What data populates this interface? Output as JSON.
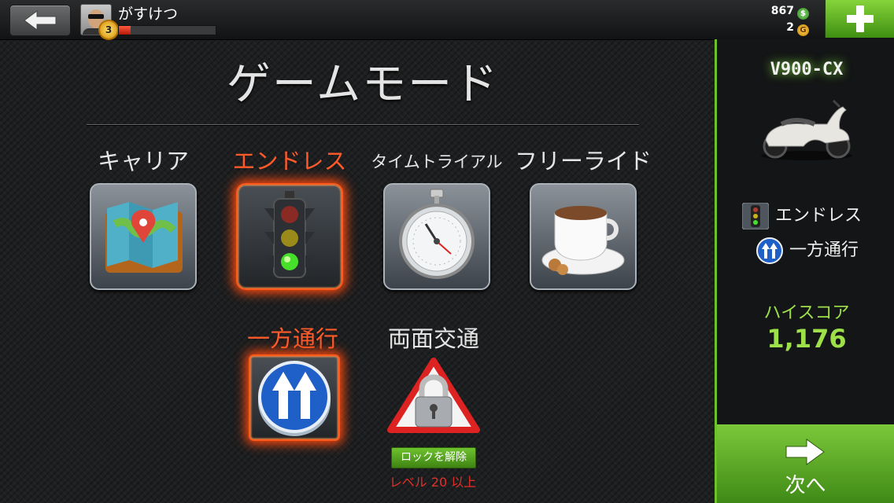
{
  "header": {
    "player_name": "がすけつ",
    "level": "3",
    "xp_progress": 0.12,
    "cash": "867",
    "cash_symbol": "$",
    "gold": "2",
    "gold_symbol": "G"
  },
  "main": {
    "title": "ゲームモード",
    "modes": [
      {
        "label": "キャリア",
        "icon": "map-pin-icon",
        "selected": false
      },
      {
        "label": "エンドレス",
        "icon": "traffic-light-icon",
        "selected": true
      },
      {
        "label": "タイムトライアル",
        "icon": "stopwatch-icon",
        "selected": false
      },
      {
        "label": "フリーライド",
        "icon": "coffee-cup-icon",
        "selected": false
      }
    ],
    "traffic": [
      {
        "label": "一方通行",
        "icon": "one-way-arrows-icon",
        "selected": true
      },
      {
        "label": "両面交通",
        "icon": "padlock-warning-icon",
        "selected": false,
        "locked": true
      }
    ],
    "unlock_button": "ロックを解除",
    "unlock_requirement": "レベル 20 以上"
  },
  "side": {
    "vehicle_name": "V900-CX",
    "selected_mode": "エンドレス",
    "selected_traffic": "一方通行",
    "hiscore_label": "ハイスコア",
    "hiscore_value": "1,176",
    "next_label": "次へ"
  },
  "colors": {
    "accent_green": "#6bc22a",
    "selected_orange": "#ff5a2a",
    "lock_red": "#e0302a"
  }
}
